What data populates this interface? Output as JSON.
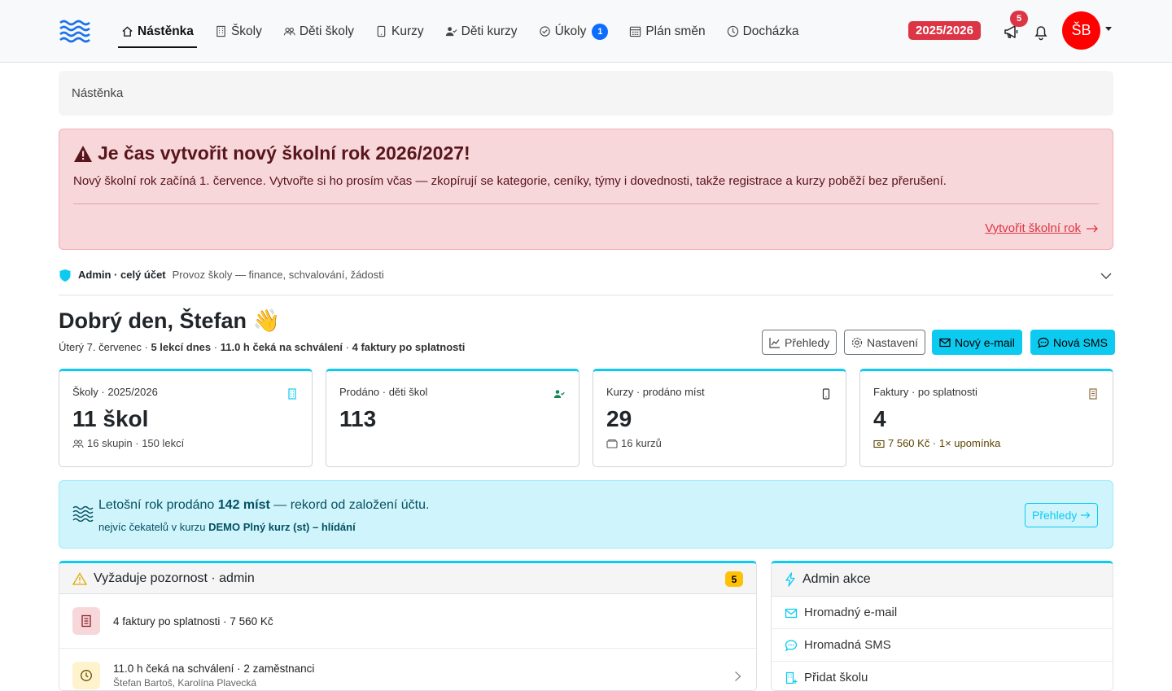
{
  "nav": {
    "items": [
      {
        "label": "Nástěnka",
        "icon": "home-icon",
        "active": true
      },
      {
        "label": "Školy",
        "icon": "building-icon"
      },
      {
        "label": "Děti školy",
        "icon": "people-icon"
      },
      {
        "label": "Kurzy",
        "icon": "tablet-icon"
      },
      {
        "label": "Děti kurzy",
        "icon": "person-check-icon"
      },
      {
        "label": "Úkoly",
        "icon": "check-circle-icon",
        "badge": "1"
      },
      {
        "label": "Plán směn",
        "icon": "calendar-icon"
      },
      {
        "label": "Docházka",
        "icon": "clock-icon"
      }
    ],
    "year": "2025/2026",
    "announcements_count": "5",
    "avatar_initials": "ŠB"
  },
  "breadcrumb": "Nástěnka",
  "alert": {
    "title": "Je čas vytvořit nový školní rok 2026/2027!",
    "text": "Nový školní rok začíná 1. července. Vytvořte si ho prosím včas — zkopírují se kategorie, ceníky, týmy i dovednosti, takže registrace a kurzy poběží bez přerušení.",
    "link": "Vytvořit školní rok"
  },
  "role": {
    "label": "Admin · celý účet",
    "description": "Provoz školy — finance, schvalování, žádosti"
  },
  "greeting": {
    "title": "Dobrý den, Štefan 👋",
    "date": "Úterý 7. červenec · ",
    "lessons": "5 lekcí dnes",
    "sep1": " · ",
    "pending": "11.0 h čeká na schválení",
    "sep2": " · ",
    "invoices": "4 faktury po splatnosti"
  },
  "actions": {
    "overview": "Přehledy",
    "settings": "Nastavení",
    "email": "Nový e-mail",
    "sms": "Nová SMS"
  },
  "cards": [
    {
      "label": "Školy · 2025/2026",
      "value": "11 škol",
      "sub": "16 skupin · 150 lekcí",
      "icon": "building-icon"
    },
    {
      "label": "Prodáno · děti škol",
      "value": "113",
      "sub": "",
      "icon": "person-check-icon"
    },
    {
      "label": "Kurzy · prodáno míst",
      "value": "29",
      "sub": "16 kurzů",
      "icon": "tablet-icon"
    },
    {
      "label": "Faktury · po splatnosti",
      "value": "4",
      "sub": "7 560 Kč · 1× upomínka",
      "icon": "receipt-icon"
    }
  ],
  "banner": {
    "pre": "Letošní rok prodáno ",
    "highlight": "142 míst",
    "post": " — rekord od založení účtu.",
    "sub_pre": "nejvíc čekatelů v kurzu ",
    "sub_course": "DEMO Plný kurz (st) – hlídání",
    "button": "Přehledy"
  },
  "attention": {
    "title": "Vyžaduje pozornost · admin",
    "count": "5",
    "items": [
      {
        "title": "4 faktury po splatnosti · 7 560 Kč",
        "sub": ""
      },
      {
        "title": "11.0 h čeká na schválení · 2 zaměstnanci",
        "sub": "Štefan Bartoš, Karolína Plavecká"
      }
    ]
  },
  "admin_actions": {
    "title": "Admin akce",
    "items": [
      "Hromadný e-mail",
      "Hromadná SMS",
      "Přidat školu"
    ]
  },
  "colors": {
    "accent": "#0dcaf0",
    "danger": "#dc3545",
    "primary": "#0d6efd",
    "warning": "#ffc107"
  }
}
